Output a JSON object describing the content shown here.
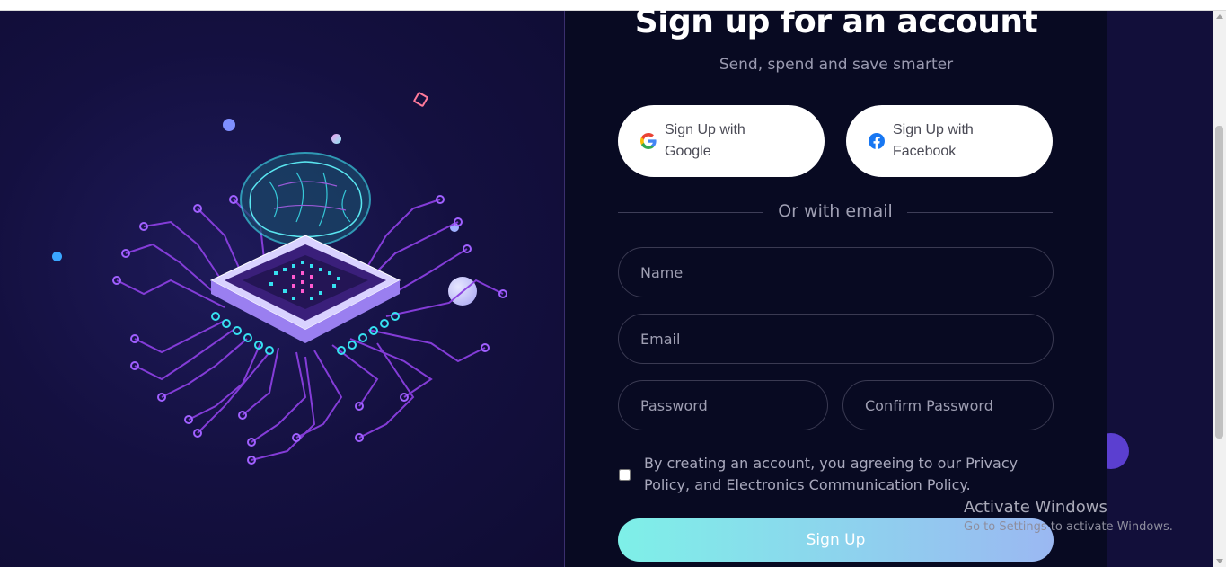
{
  "form": {
    "title": "Sign up for an account",
    "subtitle": "Send, spend and save smarter",
    "google_button": "Sign Up with Google",
    "facebook_button": "Sign Up with Facebook",
    "divider_text": "Or with email",
    "name_placeholder": "Name",
    "email_placeholder": "Email",
    "password_placeholder": "Password",
    "confirm_password_placeholder": "Confirm Password",
    "terms_text": "By creating an account, you agreeing to our Privacy Policy, and Electronics Communication Policy.",
    "terms_checked": false,
    "submit_label": "Sign Up"
  },
  "illustration": {
    "icon": "ai-chip-brain-illustration"
  },
  "watermark": {
    "line1": "Activate Windows",
    "line2": "Go to Settings to activate Windows."
  },
  "colors": {
    "background": "#120f3a",
    "form_background": "#080a22",
    "button_gradient_start": "#7ef0e8",
    "button_gradient_end": "#9bb8f2",
    "circuit": "#8a3fe0",
    "chip_glow": "#36e0f0"
  }
}
